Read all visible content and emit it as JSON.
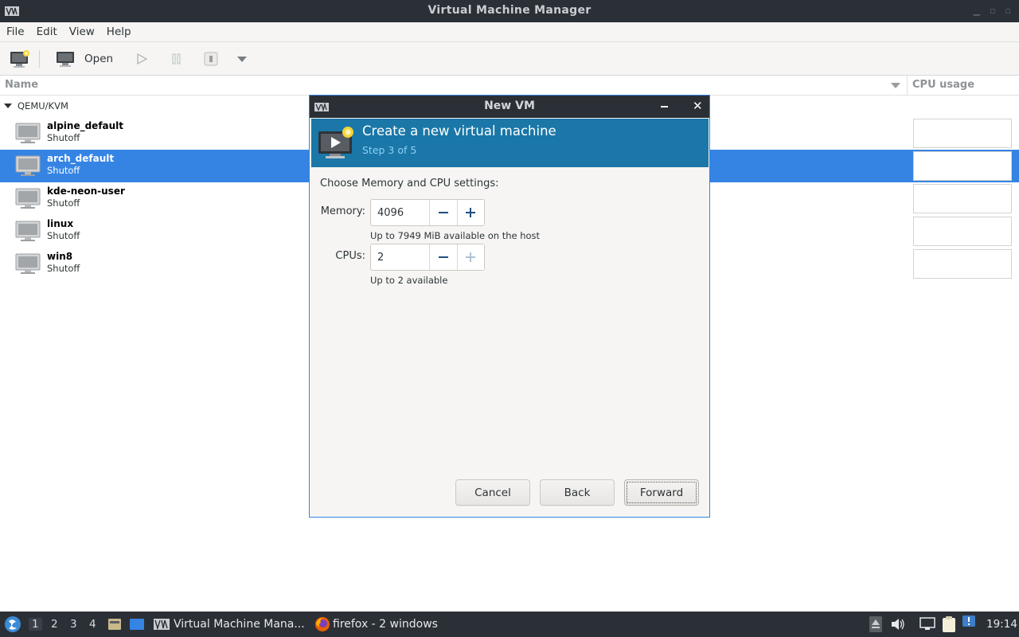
{
  "window": {
    "title": "Virtual Machine Manager"
  },
  "menubar": {
    "items": [
      "File",
      "Edit",
      "View",
      "Help"
    ]
  },
  "toolbar": {
    "open_label": "Open"
  },
  "list": {
    "name_header": "Name",
    "cpu_header": "CPU usage",
    "group": "QEMU/KVM",
    "vms": [
      {
        "name": "alpine_default",
        "state": "Shutoff"
      },
      {
        "name": "arch_default",
        "state": "Shutoff"
      },
      {
        "name": "kde-neon-user",
        "state": "Shutoff"
      },
      {
        "name": "linux",
        "state": "Shutoff"
      },
      {
        "name": "win8",
        "state": "Shutoff"
      }
    ],
    "selected_index": 1
  },
  "dialog": {
    "title": "New VM",
    "banner_title": "Create a new virtual machine",
    "banner_step": "Step 3 of 5",
    "instruction": "Choose Memory and CPU settings:",
    "memory_label": "Memory:",
    "memory_value": "4096",
    "memory_hint": "Up to 7949 MiB available on the host",
    "cpus_label": "CPUs:",
    "cpus_value": "2",
    "cpus_hint": "Up to 2 available",
    "cancel_label": "Cancel",
    "back_label": "Back",
    "forward_label": "Forward"
  },
  "taskbar": {
    "workspaces": [
      "1",
      "2",
      "3",
      "4"
    ],
    "active_workspace": "1",
    "tasks": [
      "Virtual Machine Mana...",
      "firefox - 2 windows"
    ],
    "clock": "19:14"
  },
  "colors": {
    "selection": "#3584e4",
    "banner": "#1a77a8",
    "titlebar": "#2b3037"
  }
}
